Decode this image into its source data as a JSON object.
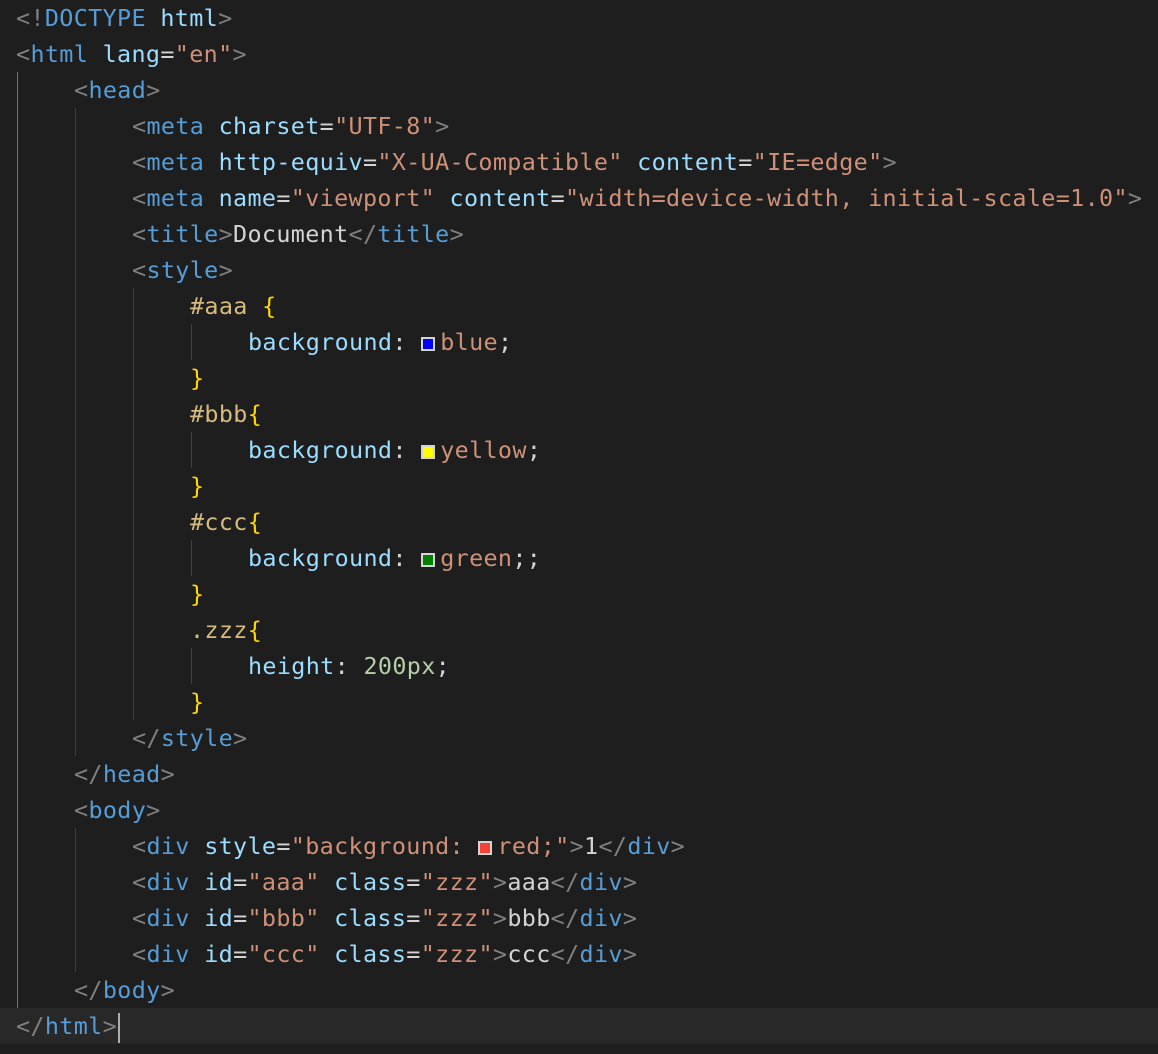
{
  "theme": {
    "background": "#1e1e1e",
    "colors": {
      "p": "#808080",
      "t": "#569cd6",
      "a": "#9cdcfe",
      "s": "#ce9178",
      "x": "#d4d4d4",
      "sel": "#d7ba7d",
      "br": "#ffd700",
      "num": "#b5cea8"
    }
  },
  "lines": [
    {
      "indent": 0,
      "tokens": [
        {
          "t": "<!",
          "c": "p"
        },
        {
          "t": "DOCTYPE",
          "c": "t"
        },
        {
          "t": " ",
          "c": "x"
        },
        {
          "t": "html",
          "c": "a"
        },
        {
          "t": ">",
          "c": "p"
        }
      ]
    },
    {
      "indent": 0,
      "tokens": [
        {
          "t": "<",
          "c": "p"
        },
        {
          "t": "html",
          "c": "t"
        },
        {
          "t": " ",
          "c": "x"
        },
        {
          "t": "lang",
          "c": "a"
        },
        {
          "t": "=",
          "c": "x"
        },
        {
          "t": "\"en\"",
          "c": "s"
        },
        {
          "t": ">",
          "c": "p"
        }
      ]
    },
    {
      "indent": 1,
      "tokens": [
        {
          "t": "<",
          "c": "p"
        },
        {
          "t": "head",
          "c": "t"
        },
        {
          "t": ">",
          "c": "p"
        }
      ]
    },
    {
      "indent": 2,
      "tokens": [
        {
          "t": "<",
          "c": "p"
        },
        {
          "t": "meta",
          "c": "t"
        },
        {
          "t": " ",
          "c": "x"
        },
        {
          "t": "charset",
          "c": "a"
        },
        {
          "t": "=",
          "c": "x"
        },
        {
          "t": "\"UTF-8\"",
          "c": "s"
        },
        {
          "t": ">",
          "c": "p"
        }
      ]
    },
    {
      "indent": 2,
      "tokens": [
        {
          "t": "<",
          "c": "p"
        },
        {
          "t": "meta",
          "c": "t"
        },
        {
          "t": " ",
          "c": "x"
        },
        {
          "t": "http-equiv",
          "c": "a"
        },
        {
          "t": "=",
          "c": "x"
        },
        {
          "t": "\"X-UA-Compatible\"",
          "c": "s"
        },
        {
          "t": " ",
          "c": "x"
        },
        {
          "t": "content",
          "c": "a"
        },
        {
          "t": "=",
          "c": "x"
        },
        {
          "t": "\"IE=edge\"",
          "c": "s"
        },
        {
          "t": ">",
          "c": "p"
        }
      ]
    },
    {
      "indent": 2,
      "tokens": [
        {
          "t": "<",
          "c": "p"
        },
        {
          "t": "meta",
          "c": "t"
        },
        {
          "t": " ",
          "c": "x"
        },
        {
          "t": "name",
          "c": "a"
        },
        {
          "t": "=",
          "c": "x"
        },
        {
          "t": "\"viewport\"",
          "c": "s"
        },
        {
          "t": " ",
          "c": "x"
        },
        {
          "t": "content",
          "c": "a"
        },
        {
          "t": "=",
          "c": "x"
        },
        {
          "t": "\"width=device-width, initial-scale=1.0\"",
          "c": "s"
        },
        {
          "t": ">",
          "c": "p"
        }
      ]
    },
    {
      "indent": 2,
      "tokens": [
        {
          "t": "<",
          "c": "p"
        },
        {
          "t": "title",
          "c": "t"
        },
        {
          "t": ">",
          "c": "p"
        },
        {
          "t": "Document",
          "c": "x"
        },
        {
          "t": "</",
          "c": "p"
        },
        {
          "t": "title",
          "c": "t"
        },
        {
          "t": ">",
          "c": "p"
        }
      ]
    },
    {
      "indent": 2,
      "tokens": [
        {
          "t": "<",
          "c": "p"
        },
        {
          "t": "style",
          "c": "t"
        },
        {
          "t": ">",
          "c": "p"
        }
      ]
    },
    {
      "indent": 3,
      "tokens": [
        {
          "t": "#aaa",
          "c": "sel"
        },
        {
          "t": " ",
          "c": "x"
        },
        {
          "t": "{",
          "c": "br"
        }
      ]
    },
    {
      "indent": 4,
      "tokens": [
        {
          "t": "background",
          "c": "a"
        },
        {
          "t": ": ",
          "c": "x"
        },
        {
          "swatch": "blue"
        },
        {
          "t": "blue",
          "c": "s"
        },
        {
          "t": ";",
          "c": "x"
        }
      ]
    },
    {
      "indent": 3,
      "tokens": [
        {
          "t": "}",
          "c": "br"
        }
      ]
    },
    {
      "indent": 3,
      "tokens": [
        {
          "t": "#bbb",
          "c": "sel"
        },
        {
          "t": "{",
          "c": "br"
        }
      ]
    },
    {
      "indent": 4,
      "tokens": [
        {
          "t": "background",
          "c": "a"
        },
        {
          "t": ": ",
          "c": "x"
        },
        {
          "swatch": "yellow"
        },
        {
          "t": "yellow",
          "c": "s"
        },
        {
          "t": ";",
          "c": "x"
        }
      ]
    },
    {
      "indent": 3,
      "tokens": [
        {
          "t": "}",
          "c": "br"
        }
      ]
    },
    {
      "indent": 3,
      "tokens": [
        {
          "t": "#ccc",
          "c": "sel"
        },
        {
          "t": "{",
          "c": "br"
        }
      ]
    },
    {
      "indent": 4,
      "tokens": [
        {
          "t": "background",
          "c": "a"
        },
        {
          "t": ": ",
          "c": "x"
        },
        {
          "swatch": "green"
        },
        {
          "t": "green",
          "c": "s"
        },
        {
          "t": ";;",
          "c": "x"
        }
      ]
    },
    {
      "indent": 3,
      "tokens": [
        {
          "t": "}",
          "c": "br"
        }
      ]
    },
    {
      "indent": 3,
      "tokens": [
        {
          "t": ".zzz",
          "c": "sel"
        },
        {
          "t": "{",
          "c": "br"
        }
      ]
    },
    {
      "indent": 4,
      "tokens": [
        {
          "t": "height",
          "c": "a"
        },
        {
          "t": ": ",
          "c": "x"
        },
        {
          "t": "200px",
          "c": "num"
        },
        {
          "t": ";",
          "c": "x"
        }
      ]
    },
    {
      "indent": 3,
      "tokens": [
        {
          "t": "}",
          "c": "br"
        }
      ]
    },
    {
      "indent": 2,
      "tokens": [
        {
          "t": "</",
          "c": "p"
        },
        {
          "t": "style",
          "c": "t"
        },
        {
          "t": ">",
          "c": "p"
        }
      ]
    },
    {
      "indent": 1,
      "tokens": [
        {
          "t": "</",
          "c": "p"
        },
        {
          "t": "head",
          "c": "t"
        },
        {
          "t": ">",
          "c": "p"
        }
      ]
    },
    {
      "indent": 1,
      "tokens": [
        {
          "t": "<",
          "c": "p"
        },
        {
          "t": "body",
          "c": "t"
        },
        {
          "t": ">",
          "c": "p"
        }
      ]
    },
    {
      "indent": 2,
      "tokens": [
        {
          "t": "<",
          "c": "p"
        },
        {
          "t": "div",
          "c": "t"
        },
        {
          "t": " ",
          "c": "x"
        },
        {
          "t": "style",
          "c": "a"
        },
        {
          "t": "=",
          "c": "x"
        },
        {
          "t": "\"background: ",
          "c": "s"
        },
        {
          "swatch": "#f44336"
        },
        {
          "t": "red;\"",
          "c": "s"
        },
        {
          "t": ">",
          "c": "p"
        },
        {
          "t": "1",
          "c": "x"
        },
        {
          "t": "</",
          "c": "p"
        },
        {
          "t": "div",
          "c": "t"
        },
        {
          "t": ">",
          "c": "p"
        }
      ]
    },
    {
      "indent": 2,
      "tokens": [
        {
          "t": "<",
          "c": "p"
        },
        {
          "t": "div",
          "c": "t"
        },
        {
          "t": " ",
          "c": "x"
        },
        {
          "t": "id",
          "c": "a"
        },
        {
          "t": "=",
          "c": "x"
        },
        {
          "t": "\"aaa\"",
          "c": "s"
        },
        {
          "t": " ",
          "c": "x"
        },
        {
          "t": "class",
          "c": "a"
        },
        {
          "t": "=",
          "c": "x"
        },
        {
          "t": "\"zzz\"",
          "c": "s"
        },
        {
          "t": ">",
          "c": "p"
        },
        {
          "t": "aaa",
          "c": "x"
        },
        {
          "t": "</",
          "c": "p"
        },
        {
          "t": "div",
          "c": "t"
        },
        {
          "t": ">",
          "c": "p"
        }
      ]
    },
    {
      "indent": 2,
      "tokens": [
        {
          "t": "<",
          "c": "p"
        },
        {
          "t": "div",
          "c": "t"
        },
        {
          "t": " ",
          "c": "x"
        },
        {
          "t": "id",
          "c": "a"
        },
        {
          "t": "=",
          "c": "x"
        },
        {
          "t": "\"bbb\"",
          "c": "s"
        },
        {
          "t": " ",
          "c": "x"
        },
        {
          "t": "class",
          "c": "a"
        },
        {
          "t": "=",
          "c": "x"
        },
        {
          "t": "\"zzz\"",
          "c": "s"
        },
        {
          "t": ">",
          "c": "p"
        },
        {
          "t": "bbb",
          "c": "x"
        },
        {
          "t": "</",
          "c": "p"
        },
        {
          "t": "div",
          "c": "t"
        },
        {
          "t": ">",
          "c": "p"
        }
      ]
    },
    {
      "indent": 2,
      "tokens": [
        {
          "t": "<",
          "c": "p"
        },
        {
          "t": "div",
          "c": "t"
        },
        {
          "t": " ",
          "c": "x"
        },
        {
          "t": "id",
          "c": "a"
        },
        {
          "t": "=",
          "c": "x"
        },
        {
          "t": "\"ccc\"",
          "c": "s"
        },
        {
          "t": " ",
          "c": "x"
        },
        {
          "t": "class",
          "c": "a"
        },
        {
          "t": "=",
          "c": "x"
        },
        {
          "t": "\"zzz\"",
          "c": "s"
        },
        {
          "t": ">",
          "c": "p"
        },
        {
          "t": "ccc",
          "c": "x"
        },
        {
          "t": "</",
          "c": "p"
        },
        {
          "t": "div",
          "c": "t"
        },
        {
          "t": ">",
          "c": "p"
        }
      ]
    },
    {
      "indent": 1,
      "tokens": [
        {
          "t": "</",
          "c": "p"
        },
        {
          "t": "body",
          "c": "t"
        },
        {
          "t": ">",
          "c": "p"
        }
      ]
    },
    {
      "indent": 0,
      "current": true,
      "cursor": true,
      "tokens": [
        {
          "t": "</",
          "c": "p"
        },
        {
          "t": "html",
          "c": "t"
        },
        {
          "t": ">",
          "c": "p"
        }
      ]
    }
  ],
  "guides": [
    {
      "level": 0,
      "from": 2,
      "to": 28,
      "active": true
    },
    {
      "level": 1,
      "from": 3,
      "to": 20,
      "active": false
    },
    {
      "level": 2,
      "from": 8,
      "to": 19,
      "active": false
    },
    {
      "level": 3,
      "from": 9,
      "to": 9,
      "active": false
    },
    {
      "level": 3,
      "from": 12,
      "to": 12,
      "active": false
    },
    {
      "level": 3,
      "from": 15,
      "to": 15,
      "active": false
    },
    {
      "level": 3,
      "from": 18,
      "to": 18,
      "active": false
    },
    {
      "level": 1,
      "from": 23,
      "to": 26,
      "active": false
    }
  ]
}
